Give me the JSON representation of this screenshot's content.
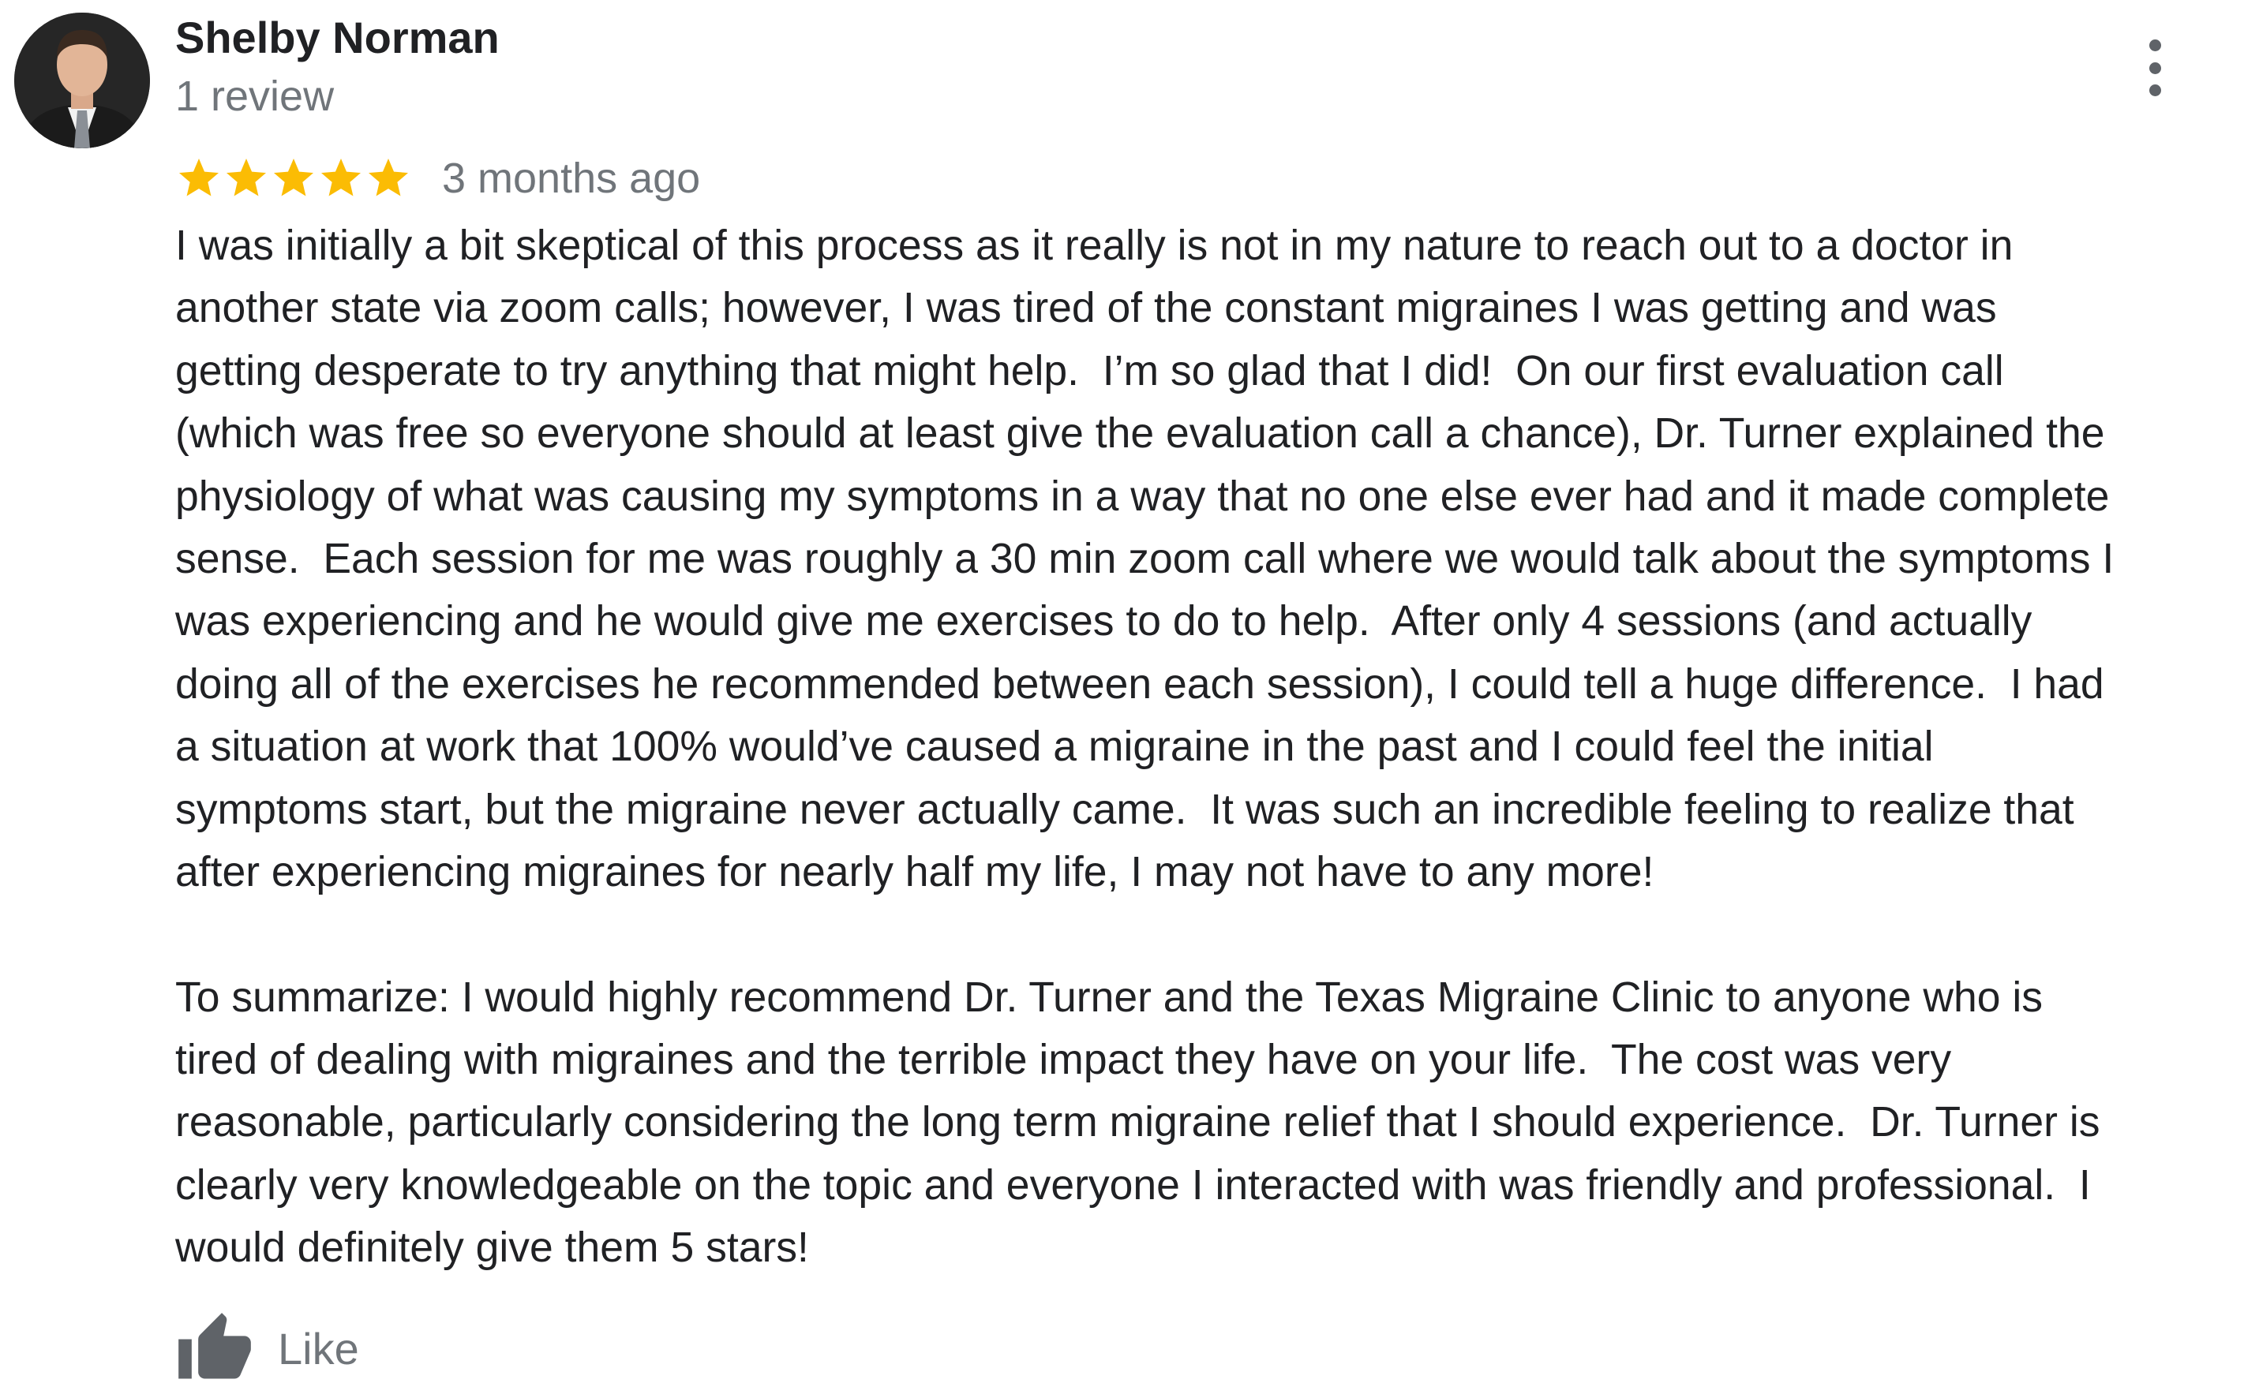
{
  "reviewer": {
    "name": "Shelby Norman",
    "review_count": "1 review",
    "avatar_icon": "person-avatar"
  },
  "rating": {
    "stars": 5,
    "max_stars": 5,
    "star_color": "#fbbc04",
    "date": "3 months ago"
  },
  "review": {
    "paragraphs": [
      [
        "I was initially a bit skeptical of this process as it really is not in my nature to reach out to a doctor in",
        "another state via zoom calls; however, I was tired of the constant migraines I was getting and was",
        "getting desperate to try anything that might help.  I’m so glad that I did!  On our first evaluation call",
        "(which was free so everyone should at least give the evaluation call a chance), Dr. Turner explained the",
        "physiology of what was causing my symptoms in a way that no one else ever had and it made complete",
        "sense.  Each session for me was roughly a 30 min zoom call where we would talk about the symptoms I",
        "was experiencing and he would give me exercises to do to help.  After only 4 sessions (and actually",
        "doing all of the exercises he recommended between each session), I could tell a huge difference.  I had",
        "a situation at work that 100% would’ve caused a migraine in the past and I could feel the initial",
        "symptoms start, but the migraine never actually came.  It was such an incredible feeling to realize that",
        "after experiencing migraines for nearly half my life, I may not have to any more!"
      ],
      [
        "To summarize: I would highly recommend Dr. Turner and the Texas Migraine Clinic to anyone who is",
        "tired of dealing with migraines and the terrible impact they have on your life.  The cost was very",
        "reasonable, particularly considering the long term migraine relief that I should experience.  Dr. Turner is",
        "clearly very knowledgeable on the topic and everyone I interacted with was friendly and professional.  I",
        "would definitely give them 5 stars!"
      ]
    ]
  },
  "actions": {
    "like_label": "Like",
    "like_icon": "thumbs-up-icon",
    "more_icon": "more-vert-icon"
  }
}
